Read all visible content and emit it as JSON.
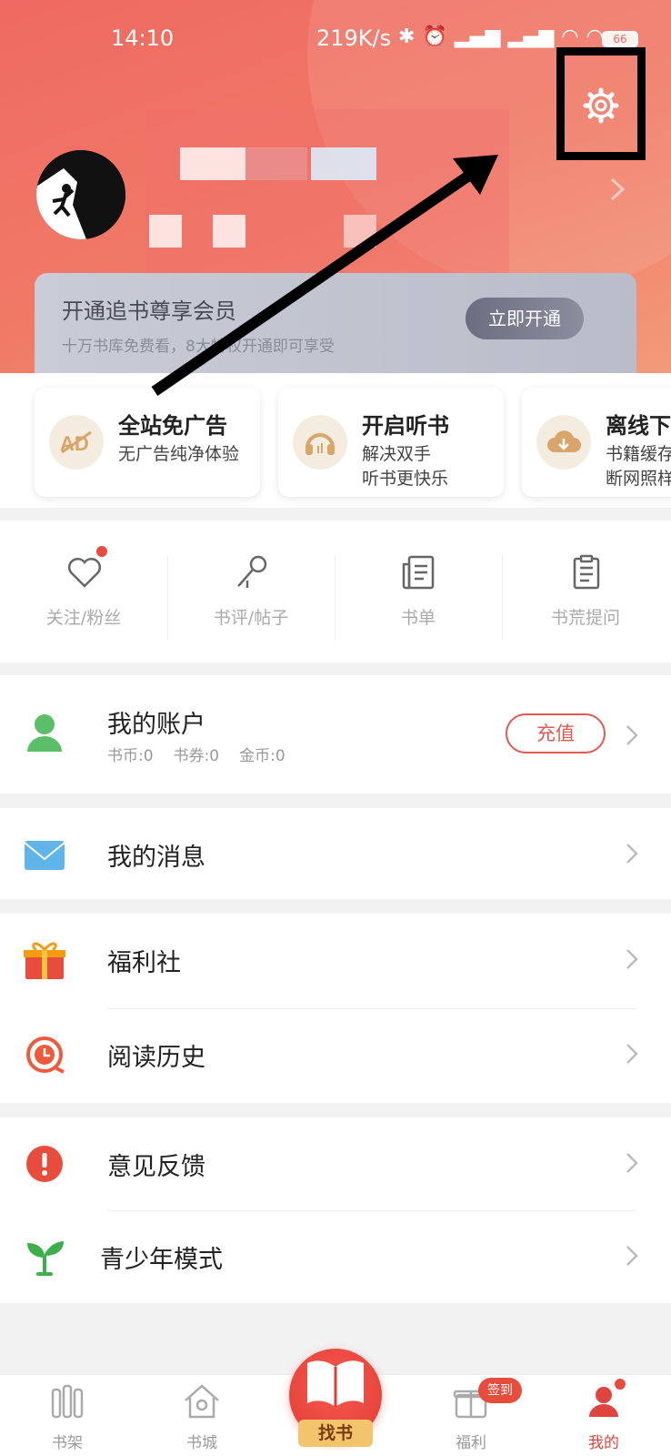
{
  "status_bar": {
    "time": "14:10",
    "speed": "219K/s",
    "battery": "66"
  },
  "vip": {
    "title": "开通追书尊享会员",
    "subtitle": "十万书库免费看，8大特权开通即可享受",
    "button": "立即开通"
  },
  "features": [
    {
      "title": "全站免广告",
      "subtitle": "无广告纯净体验",
      "icon": "no-ad-icon"
    },
    {
      "title": "开启听书",
      "subtitle": "解决双手\n听书更快乐",
      "icon": "headphones-icon"
    },
    {
      "title": "离线下",
      "subtitle": "书籍缓存\n断网照样",
      "icon": "cloud-download-icon"
    }
  ],
  "social": [
    {
      "label": "关注/粉丝",
      "icon": "heart-icon"
    },
    {
      "label": "书评/帖子",
      "icon": "microphone-icon"
    },
    {
      "label": "书单",
      "icon": "book-list-icon"
    },
    {
      "label": "书荒提问",
      "icon": "clipboard-icon"
    }
  ],
  "account": {
    "title": "我的账户",
    "coins": "书币:0",
    "vouchers": "书券:0",
    "gold": "金币:0",
    "recharge": "充值"
  },
  "messages": {
    "title": "我的消息"
  },
  "welfare": {
    "title": "福利社"
  },
  "history": {
    "title": "阅读历史"
  },
  "feedback": {
    "title": "意见反馈"
  },
  "youth": {
    "title": "青少年模式"
  },
  "tabbar": {
    "shelf": "书架",
    "store": "书城",
    "find": "找书",
    "welfare": "福利",
    "sign_badge": "签到",
    "mine": "我的"
  },
  "colors": {
    "header": "#ef6a62",
    "accent": "#e0443e",
    "vip_button": "#6b6d80"
  }
}
